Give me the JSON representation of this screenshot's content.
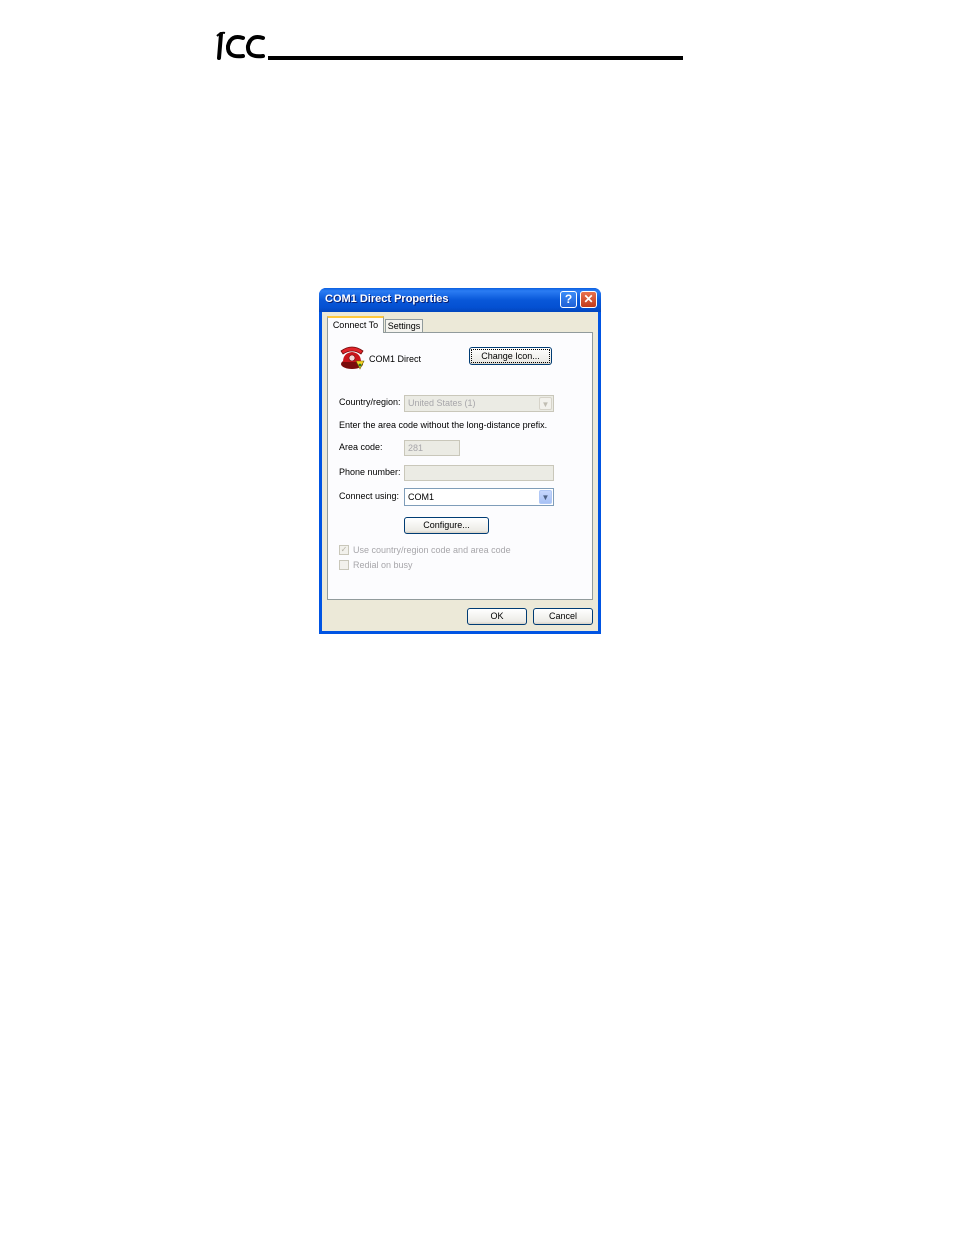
{
  "header": {
    "logo_text": "ICC"
  },
  "dialog": {
    "title": "COM1 Direct Properties",
    "help_label": "?",
    "close_label": "✕",
    "tabs": [
      {
        "label": "Connect To",
        "active": true
      },
      {
        "label": "Settings",
        "active": false
      }
    ],
    "connection_name": "COM1 Direct",
    "change_icon_label": "Change Icon...",
    "country_label": "Country/region:",
    "country_value": "United States (1)",
    "instruction": "Enter the area code without the long-distance prefix.",
    "area_code_label": "Area code:",
    "area_code_value": "281",
    "phone_label": "Phone number:",
    "phone_value": "",
    "connect_using_label": "Connect using:",
    "connect_using_value": "COM1",
    "configure_label": "Configure...",
    "use_country_label": "Use country/region code and area code",
    "use_country_checked": true,
    "redial_label": "Redial on busy",
    "redial_checked": false,
    "ok_label": "OK",
    "cancel_label": "Cancel"
  },
  "icons": {
    "logo": "icc-logo",
    "connection": "red-telephone-icon",
    "dropdown": "chevron-down-icon"
  }
}
